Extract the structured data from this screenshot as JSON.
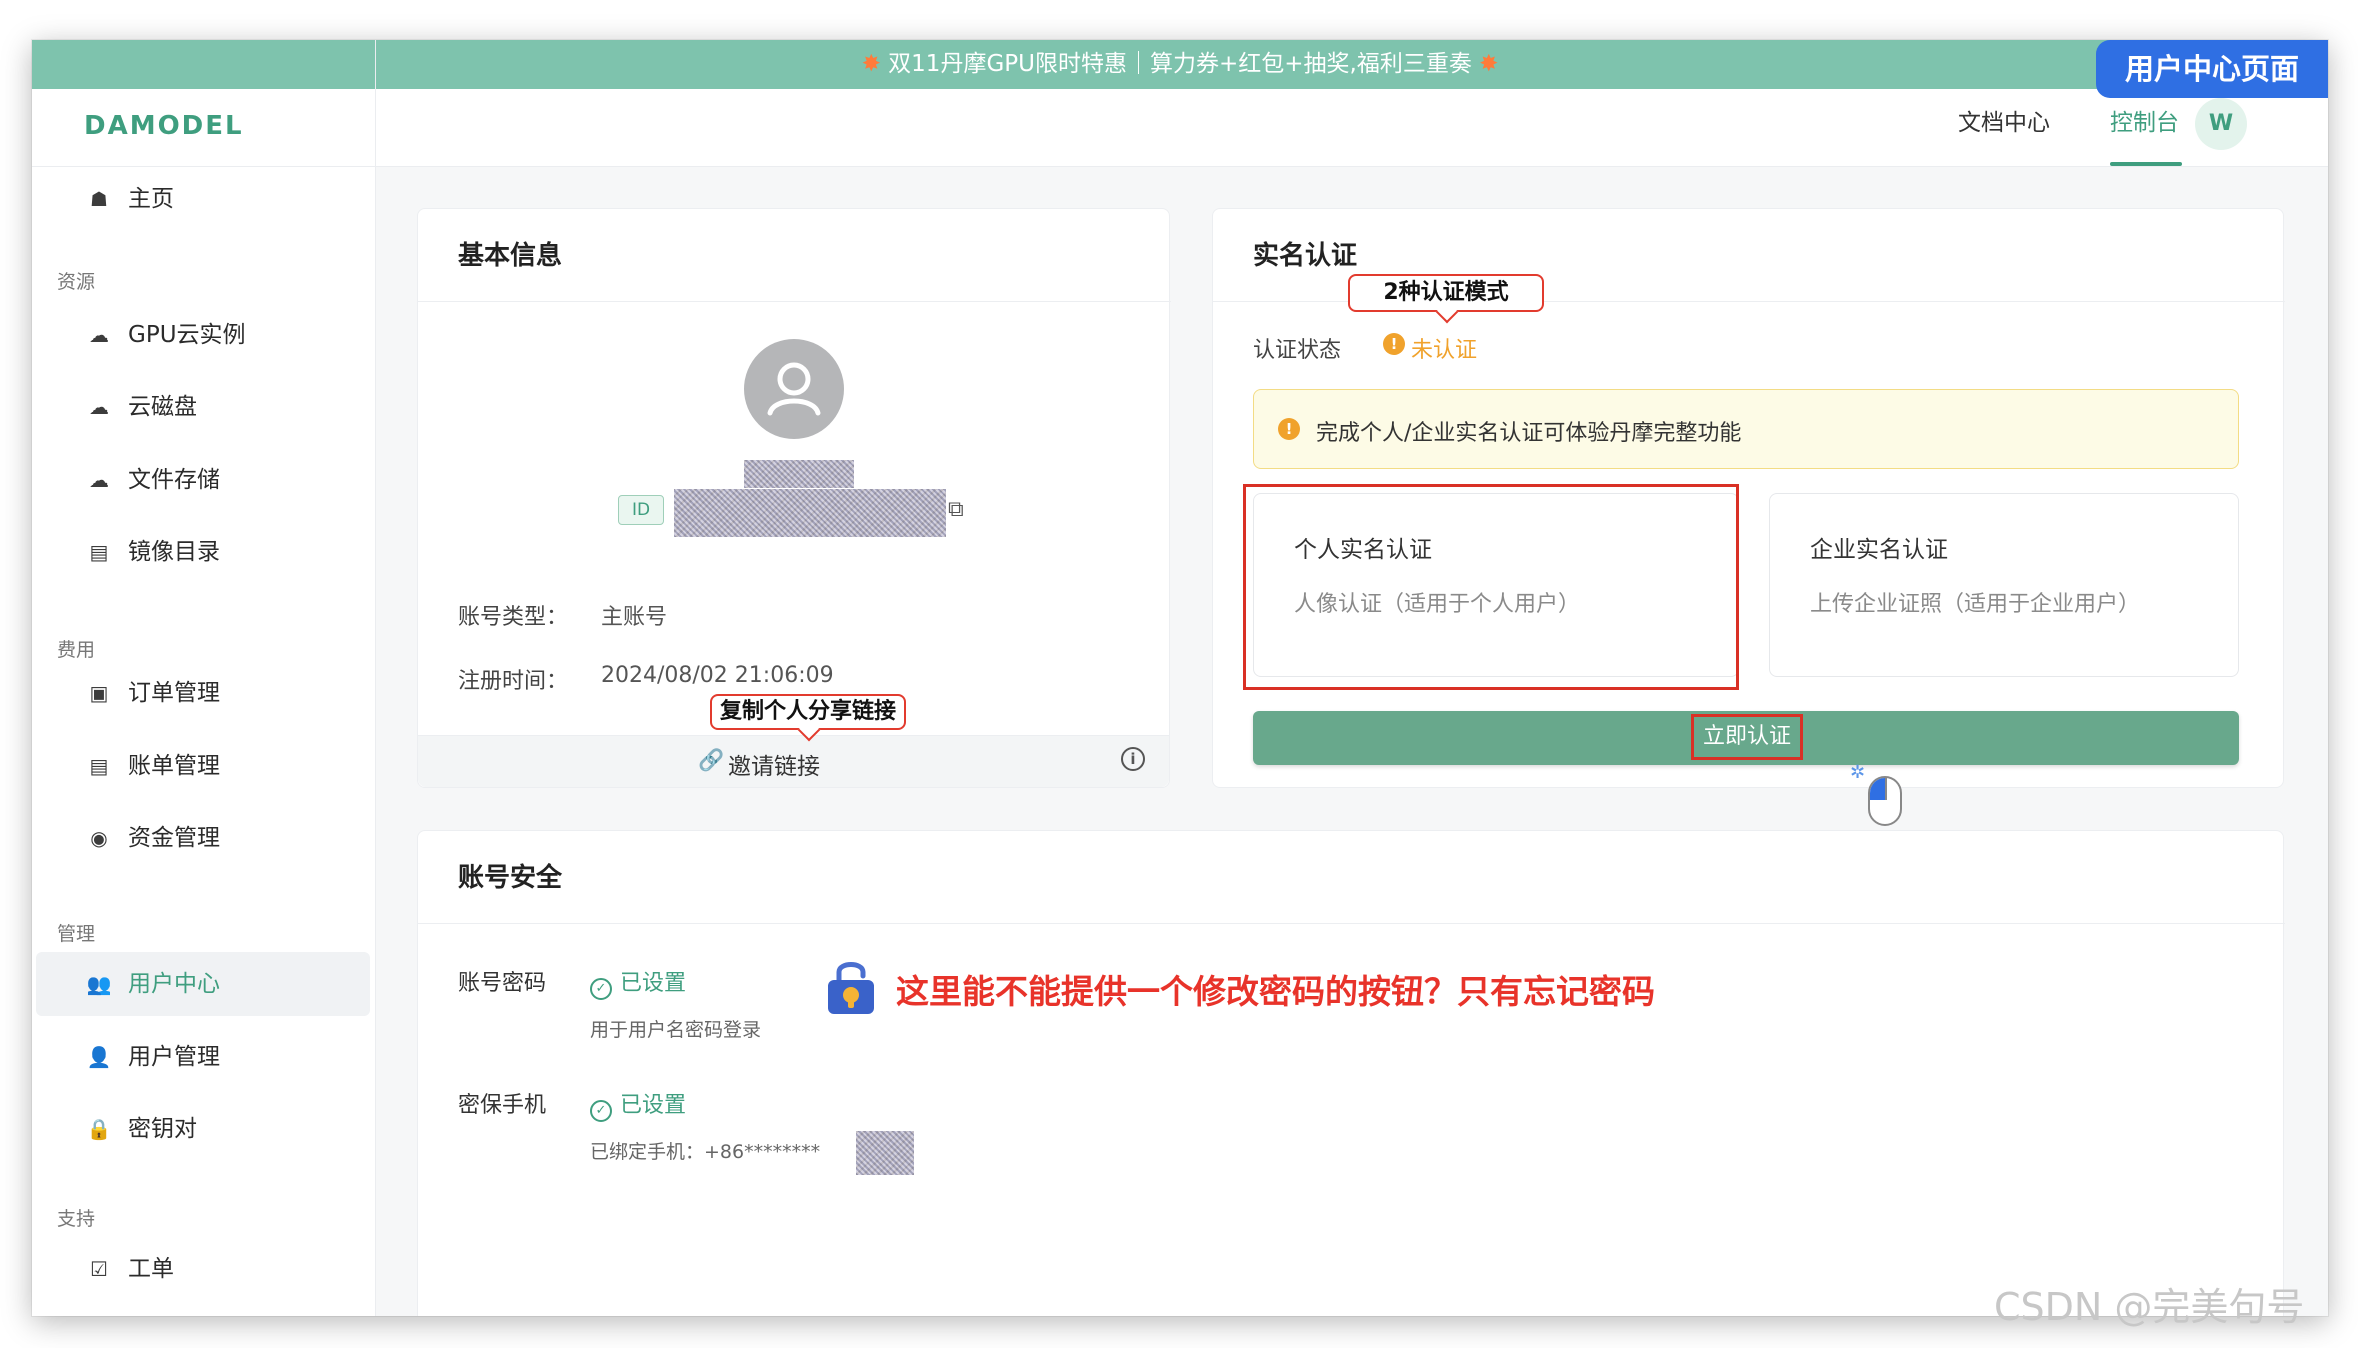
{
  "banner": {
    "text": "双11丹摩GPU限时特惠｜算力券+红包+抽奖,福利三重奏"
  },
  "page_tag": "用户中心页面",
  "logo": "DAMODEL",
  "top_nav": {
    "docs": "文档中心",
    "console": "控制台",
    "avatar_initial": "W"
  },
  "sidebar": {
    "home": "主页",
    "sections": {
      "resources": "资源",
      "billing": "费用",
      "manage": "管理",
      "support": "支持"
    },
    "items": {
      "gpu": "GPU云实例",
      "disk": "云磁盘",
      "file_storage": "文件存储",
      "images": "镜像目录",
      "orders": "订单管理",
      "bills": "账单管理",
      "funds": "资金管理",
      "user_center": "用户中心",
      "user_mgmt": "用户管理",
      "keys": "密钥对",
      "tickets": "工单"
    },
    "icons": {
      "home": "home-icon",
      "gpu": "cloud-icon",
      "disk": "cloud-disk-icon",
      "file_storage": "cloud-upload-icon",
      "images": "book-icon",
      "orders": "order-icon",
      "bills": "list-icon",
      "funds": "yen-icon",
      "user_center": "users-icon",
      "user_mgmt": "user-gear-icon",
      "keys": "lock-icon",
      "tickets": "checkbox-icon"
    },
    "active": "user_center"
  },
  "basic_info": {
    "title": "基本信息",
    "id_tag": "ID",
    "account_type_label": "账号类型：",
    "account_type_value": "主账号",
    "register_label": "注册时间：",
    "register_value": "2024/08/02 21:06:09",
    "invite_label": "邀请链接",
    "callout": "复制个人分享链接"
  },
  "verification": {
    "title": "实名认证",
    "callout": "2种认证模式",
    "status_label": "认证状态",
    "status_value": "未认证",
    "notice": "完成个人/企业实名认证可体验丹摩完整功能",
    "personal_title": "个人实名认证",
    "personal_desc": "人像认证（适用于个人用户）",
    "enterprise_title": "企业实名认证",
    "enterprise_desc": "上传企业证照（适用于企业用户）",
    "button": "立即认证"
  },
  "security": {
    "title": "账号安全",
    "password_label": "账号密码",
    "password_status": "已设置",
    "password_desc": "用于用户名密码登录",
    "phone_label": "密保手机",
    "phone_status": "已设置",
    "phone_desc": "已绑定手机：+86********",
    "annotation": "这里能不能提供一个修改密码的按钮？只有忘记密码"
  },
  "watermark": "CSDN @完美句号",
  "colors": {
    "brand": "#3f9e7f",
    "banner": "#7ec3ad",
    "warning": "#f0a22c",
    "annotation_red": "#e8332a",
    "tag_blue": "#2f6fe3"
  }
}
